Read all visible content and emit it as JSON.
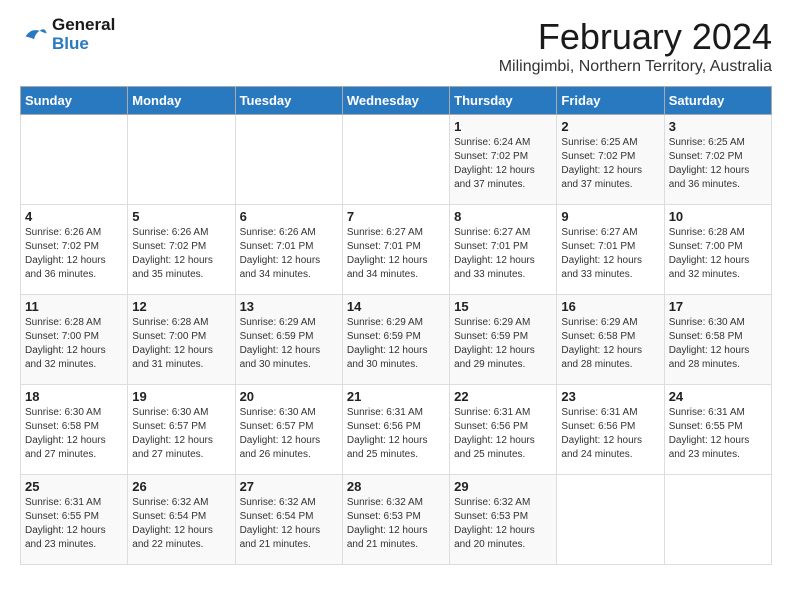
{
  "logo": {
    "line1": "General",
    "line2": "Blue"
  },
  "title": "February 2024",
  "subtitle": "Milingimbi, Northern Territory, Australia",
  "headers": [
    "Sunday",
    "Monday",
    "Tuesday",
    "Wednesday",
    "Thursday",
    "Friday",
    "Saturday"
  ],
  "weeks": [
    [
      {
        "day": "",
        "sunrise": "",
        "sunset": "",
        "daylight": ""
      },
      {
        "day": "",
        "sunrise": "",
        "sunset": "",
        "daylight": ""
      },
      {
        "day": "",
        "sunrise": "",
        "sunset": "",
        "daylight": ""
      },
      {
        "day": "",
        "sunrise": "",
        "sunset": "",
        "daylight": ""
      },
      {
        "day": "1",
        "sunrise": "Sunrise: 6:24 AM",
        "sunset": "Sunset: 7:02 PM",
        "daylight": "Daylight: 12 hours and 37 minutes."
      },
      {
        "day": "2",
        "sunrise": "Sunrise: 6:25 AM",
        "sunset": "Sunset: 7:02 PM",
        "daylight": "Daylight: 12 hours and 37 minutes."
      },
      {
        "day": "3",
        "sunrise": "Sunrise: 6:25 AM",
        "sunset": "Sunset: 7:02 PM",
        "daylight": "Daylight: 12 hours and 36 minutes."
      }
    ],
    [
      {
        "day": "4",
        "sunrise": "Sunrise: 6:26 AM",
        "sunset": "Sunset: 7:02 PM",
        "daylight": "Daylight: 12 hours and 36 minutes."
      },
      {
        "day": "5",
        "sunrise": "Sunrise: 6:26 AM",
        "sunset": "Sunset: 7:02 PM",
        "daylight": "Daylight: 12 hours and 35 minutes."
      },
      {
        "day": "6",
        "sunrise": "Sunrise: 6:26 AM",
        "sunset": "Sunset: 7:01 PM",
        "daylight": "Daylight: 12 hours and 34 minutes."
      },
      {
        "day": "7",
        "sunrise": "Sunrise: 6:27 AM",
        "sunset": "Sunset: 7:01 PM",
        "daylight": "Daylight: 12 hours and 34 minutes."
      },
      {
        "day": "8",
        "sunrise": "Sunrise: 6:27 AM",
        "sunset": "Sunset: 7:01 PM",
        "daylight": "Daylight: 12 hours and 33 minutes."
      },
      {
        "day": "9",
        "sunrise": "Sunrise: 6:27 AM",
        "sunset": "Sunset: 7:01 PM",
        "daylight": "Daylight: 12 hours and 33 minutes."
      },
      {
        "day": "10",
        "sunrise": "Sunrise: 6:28 AM",
        "sunset": "Sunset: 7:00 PM",
        "daylight": "Daylight: 12 hours and 32 minutes."
      }
    ],
    [
      {
        "day": "11",
        "sunrise": "Sunrise: 6:28 AM",
        "sunset": "Sunset: 7:00 PM",
        "daylight": "Daylight: 12 hours and 32 minutes."
      },
      {
        "day": "12",
        "sunrise": "Sunrise: 6:28 AM",
        "sunset": "Sunset: 7:00 PM",
        "daylight": "Daylight: 12 hours and 31 minutes."
      },
      {
        "day": "13",
        "sunrise": "Sunrise: 6:29 AM",
        "sunset": "Sunset: 6:59 PM",
        "daylight": "Daylight: 12 hours and 30 minutes."
      },
      {
        "day": "14",
        "sunrise": "Sunrise: 6:29 AM",
        "sunset": "Sunset: 6:59 PM",
        "daylight": "Daylight: 12 hours and 30 minutes."
      },
      {
        "day": "15",
        "sunrise": "Sunrise: 6:29 AM",
        "sunset": "Sunset: 6:59 PM",
        "daylight": "Daylight: 12 hours and 29 minutes."
      },
      {
        "day": "16",
        "sunrise": "Sunrise: 6:29 AM",
        "sunset": "Sunset: 6:58 PM",
        "daylight": "Daylight: 12 hours and 28 minutes."
      },
      {
        "day": "17",
        "sunrise": "Sunrise: 6:30 AM",
        "sunset": "Sunset: 6:58 PM",
        "daylight": "Daylight: 12 hours and 28 minutes."
      }
    ],
    [
      {
        "day": "18",
        "sunrise": "Sunrise: 6:30 AM",
        "sunset": "Sunset: 6:58 PM",
        "daylight": "Daylight: 12 hours and 27 minutes."
      },
      {
        "day": "19",
        "sunrise": "Sunrise: 6:30 AM",
        "sunset": "Sunset: 6:57 PM",
        "daylight": "Daylight: 12 hours and 27 minutes."
      },
      {
        "day": "20",
        "sunrise": "Sunrise: 6:30 AM",
        "sunset": "Sunset: 6:57 PM",
        "daylight": "Daylight: 12 hours and 26 minutes."
      },
      {
        "day": "21",
        "sunrise": "Sunrise: 6:31 AM",
        "sunset": "Sunset: 6:56 PM",
        "daylight": "Daylight: 12 hours and 25 minutes."
      },
      {
        "day": "22",
        "sunrise": "Sunrise: 6:31 AM",
        "sunset": "Sunset: 6:56 PM",
        "daylight": "Daylight: 12 hours and 25 minutes."
      },
      {
        "day": "23",
        "sunrise": "Sunrise: 6:31 AM",
        "sunset": "Sunset: 6:56 PM",
        "daylight": "Daylight: 12 hours and 24 minutes."
      },
      {
        "day": "24",
        "sunrise": "Sunrise: 6:31 AM",
        "sunset": "Sunset: 6:55 PM",
        "daylight": "Daylight: 12 hours and 23 minutes."
      }
    ],
    [
      {
        "day": "25",
        "sunrise": "Sunrise: 6:31 AM",
        "sunset": "Sunset: 6:55 PM",
        "daylight": "Daylight: 12 hours and 23 minutes."
      },
      {
        "day": "26",
        "sunrise": "Sunrise: 6:32 AM",
        "sunset": "Sunset: 6:54 PM",
        "daylight": "Daylight: 12 hours and 22 minutes."
      },
      {
        "day": "27",
        "sunrise": "Sunrise: 6:32 AM",
        "sunset": "Sunset: 6:54 PM",
        "daylight": "Daylight: 12 hours and 21 minutes."
      },
      {
        "day": "28",
        "sunrise": "Sunrise: 6:32 AM",
        "sunset": "Sunset: 6:53 PM",
        "daylight": "Daylight: 12 hours and 21 minutes."
      },
      {
        "day": "29",
        "sunrise": "Sunrise: 6:32 AM",
        "sunset": "Sunset: 6:53 PM",
        "daylight": "Daylight: 12 hours and 20 minutes."
      },
      {
        "day": "",
        "sunrise": "",
        "sunset": "",
        "daylight": ""
      },
      {
        "day": "",
        "sunrise": "",
        "sunset": "",
        "daylight": ""
      }
    ]
  ]
}
